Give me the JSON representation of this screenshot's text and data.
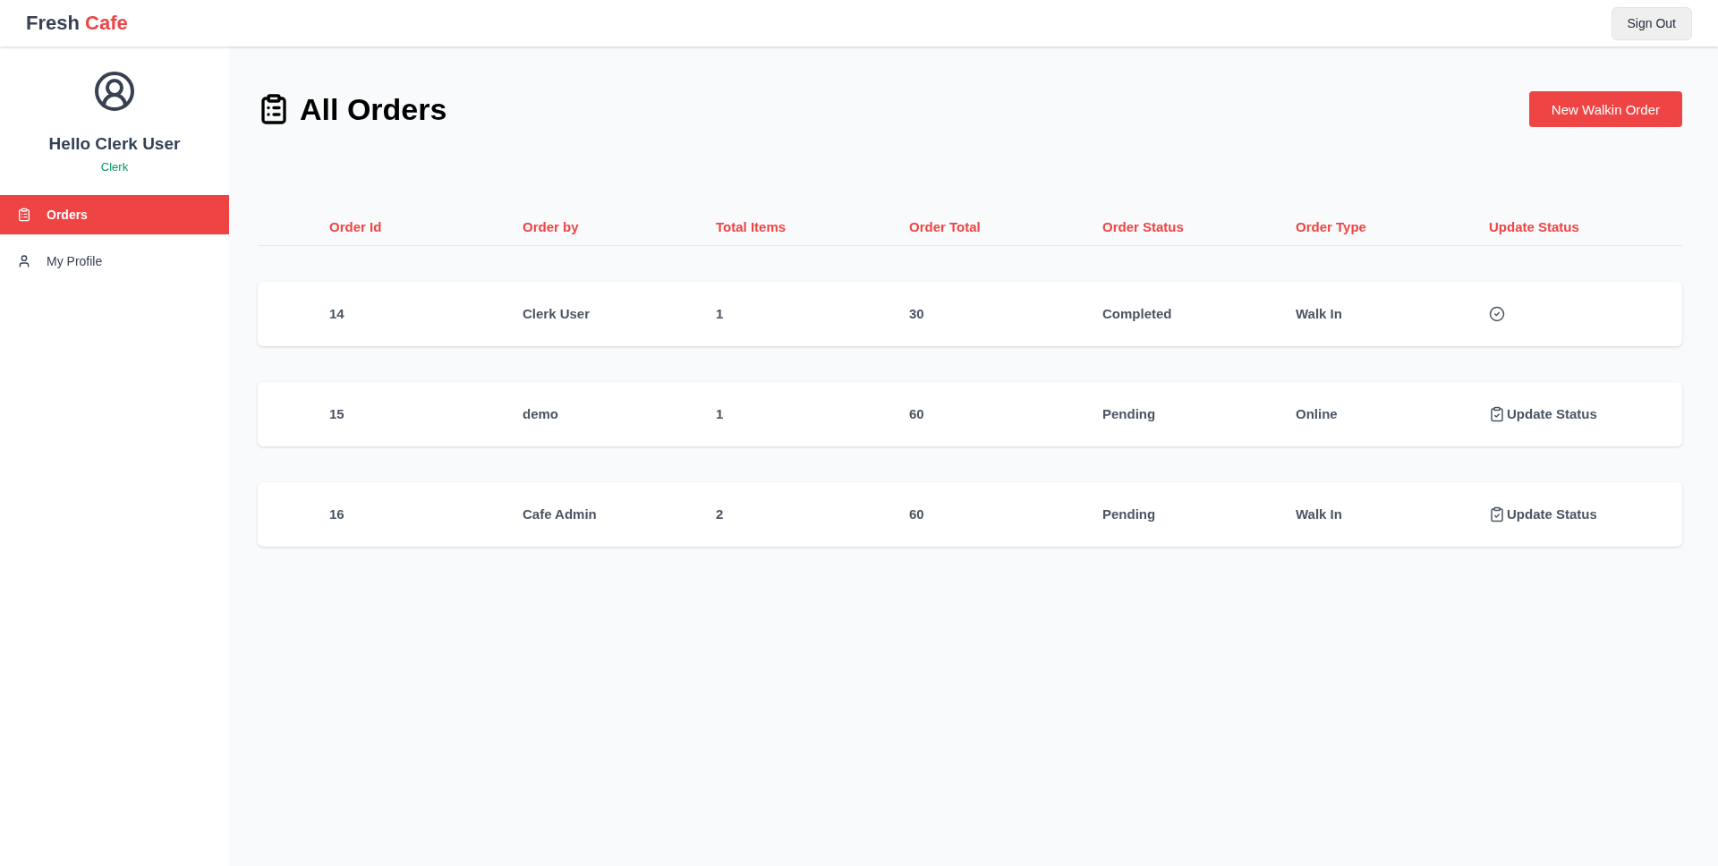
{
  "header": {
    "logo": {
      "primary": "Fresh",
      "accent": "Cafe"
    },
    "sign_out": "Sign Out"
  },
  "sidebar": {
    "greeting": "Hello Clerk User",
    "role": "Clerk",
    "items": [
      {
        "kind": "orders",
        "label": "Orders",
        "selected": true
      },
      {
        "kind": "profile",
        "label": "My Profile",
        "selected": false
      }
    ]
  },
  "page": {
    "title": "All Orders",
    "new_order_button": "New Walkin Order"
  },
  "table": {
    "columns": [
      "Order Id",
      "Order by",
      "Total Items",
      "Order Total",
      "Order Status",
      "Order Type",
      "Update Status"
    ],
    "rows": [
      {
        "cells": [
          "14",
          "Clerk User",
          "1",
          "30",
          "Completed",
          "Walk In"
        ],
        "update_status": {
          "kind": "done"
        }
      },
      {
        "cells": [
          "15",
          "demo",
          "1",
          "60",
          "Pending",
          "Online"
        ],
        "update_status": {
          "kind": "button",
          "label": "Update Status"
        }
      },
      {
        "cells": [
          "16",
          "Cafe Admin",
          "2",
          "60",
          "Pending",
          "Walk In"
        ],
        "update_status": {
          "kind": "button",
          "label": "Update Status"
        }
      }
    ]
  }
}
